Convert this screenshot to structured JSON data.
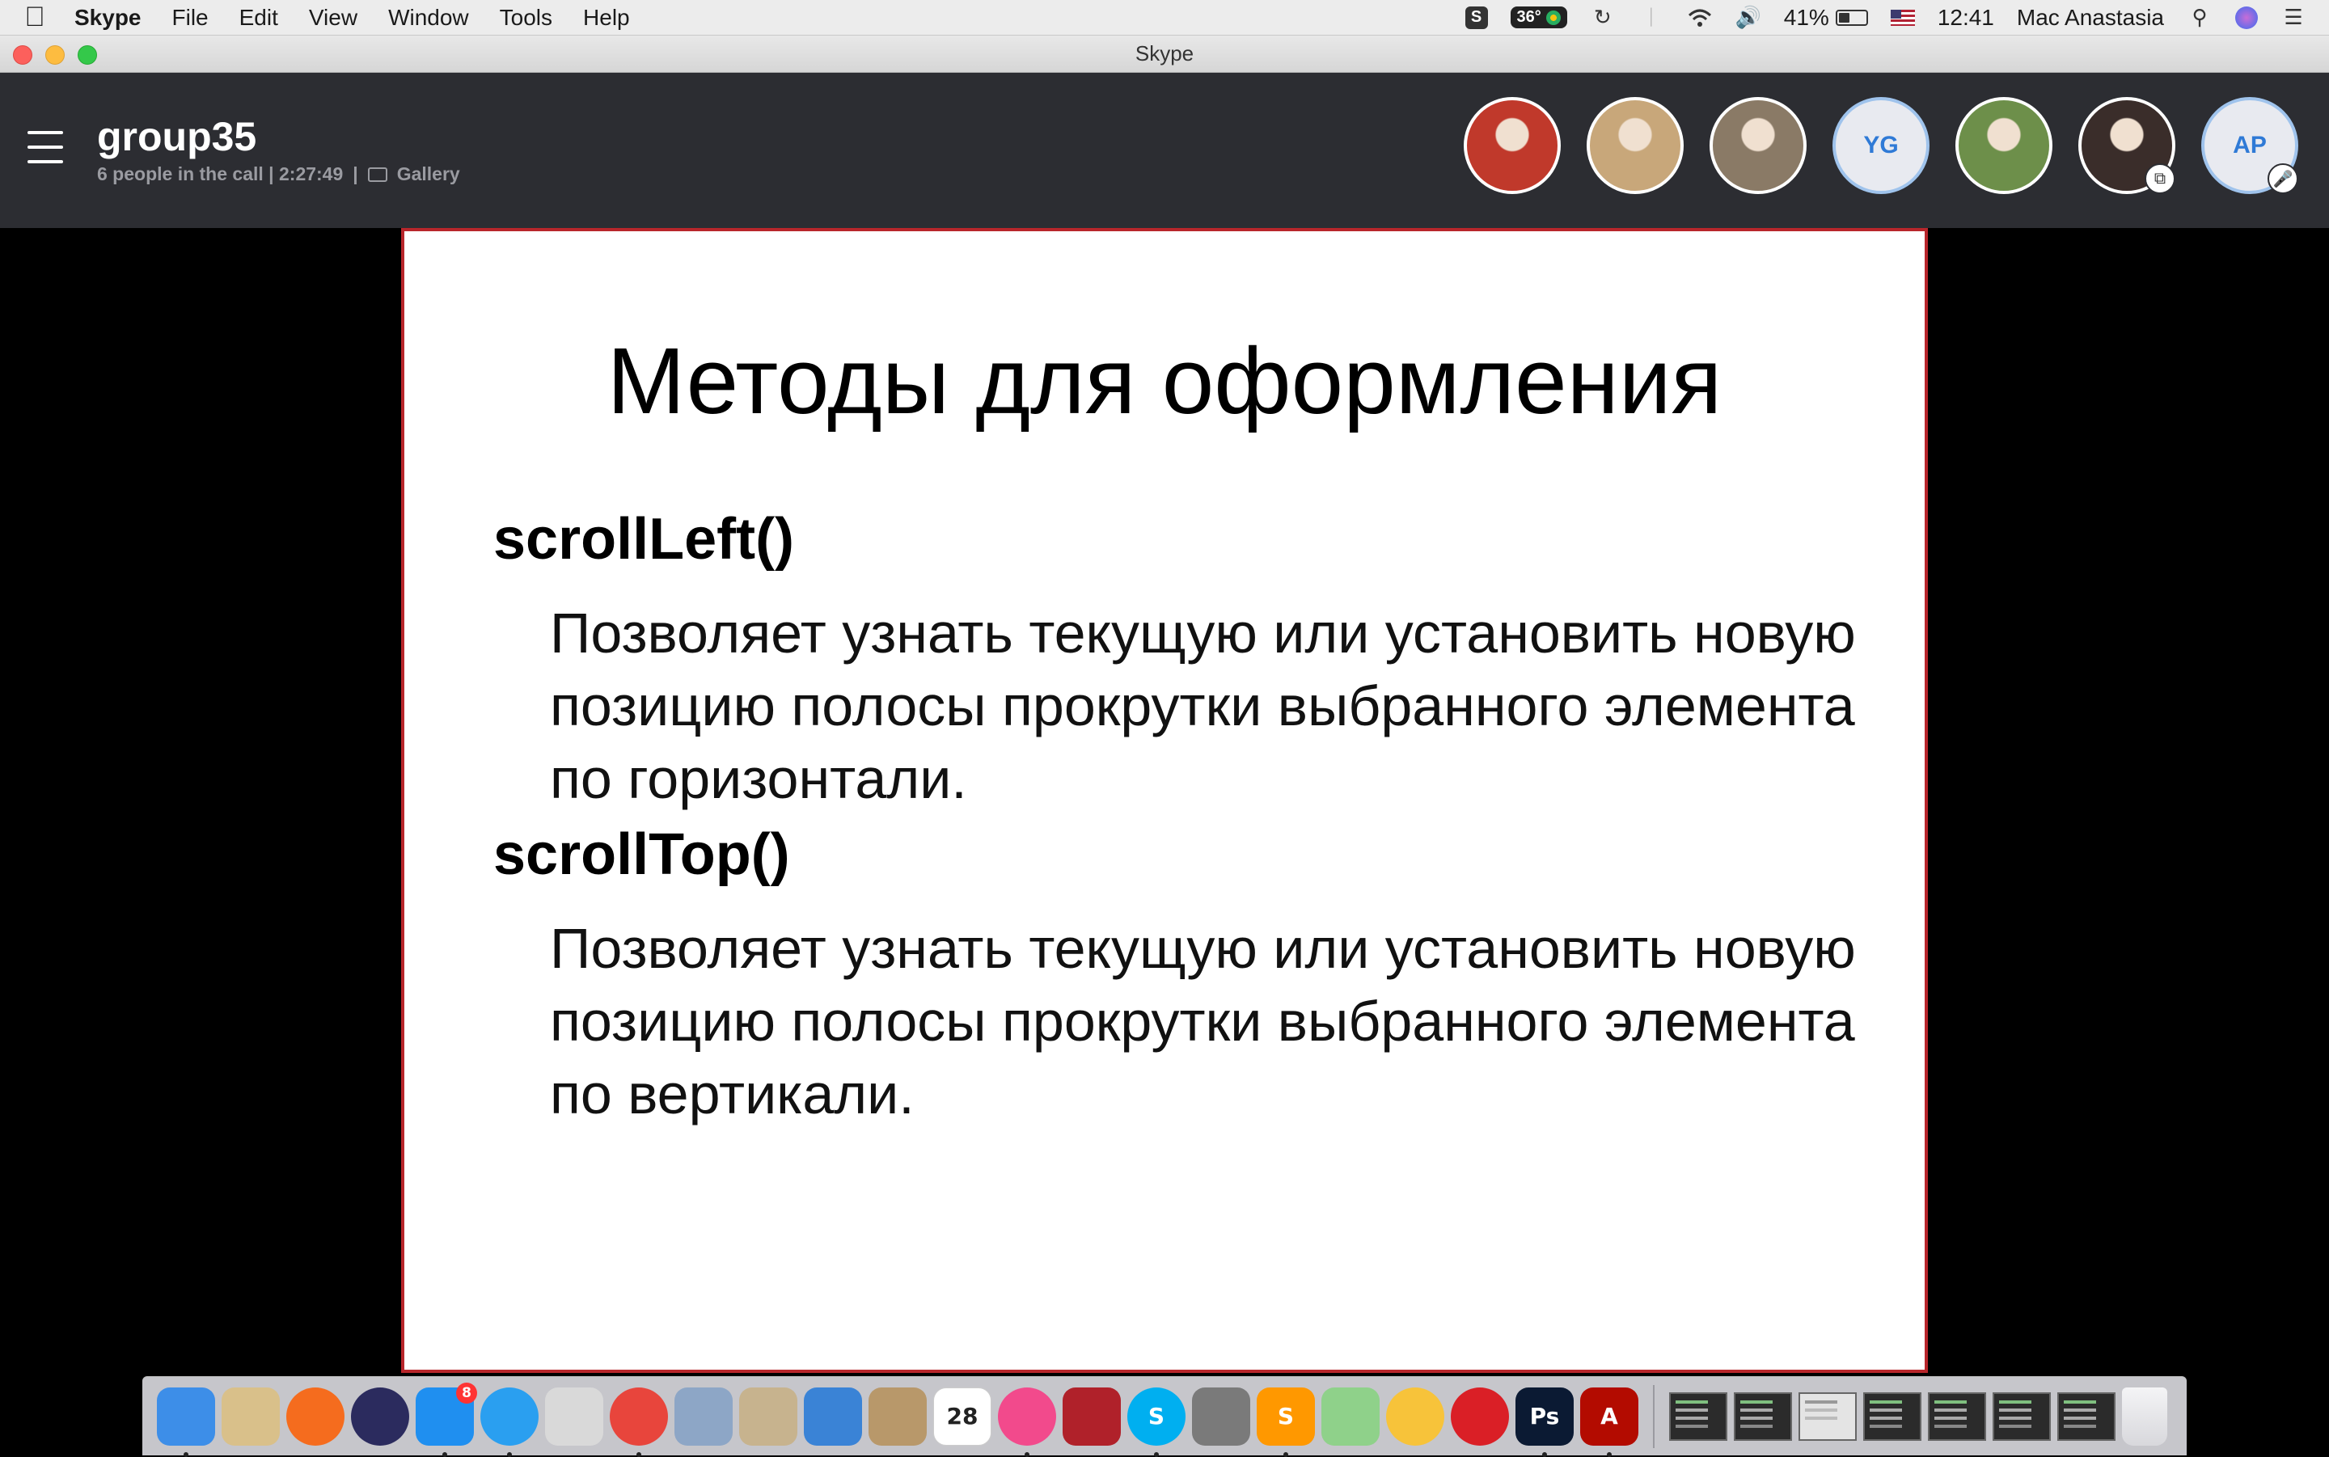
{
  "menubar": {
    "app_name": "Skype",
    "items": [
      "File",
      "Edit",
      "View",
      "Window",
      "Tools",
      "Help"
    ],
    "temperature": "36°",
    "battery_percent": "41%",
    "battery_level": 0.41,
    "time": "12:41",
    "user": "Mac Anastasia"
  },
  "window": {
    "title": "Skype"
  },
  "call": {
    "title": "group35",
    "status": "6 people in the call | 2:27:49",
    "separator": "|",
    "view_mode": "Gallery",
    "participants": [
      {
        "type": "photo",
        "icon": "devil-avatar",
        "color": "#c0392b"
      },
      {
        "type": "photo",
        "icon": "blonde-woman-avatar",
        "color": "#c8a77a"
      },
      {
        "type": "photo",
        "icon": "man-avatar",
        "color": "#8a7a66"
      },
      {
        "type": "initials",
        "initials": "YG"
      },
      {
        "type": "photo",
        "icon": "outdoor-man-avatar",
        "color": "#6d8f4a"
      },
      {
        "type": "photo",
        "icon": "woman-dark-hair-avatar",
        "color": "#3a2d2a",
        "badge": "share-icon"
      },
      {
        "type": "initials",
        "initials": "AP",
        "badge": "mic-muted-icon"
      }
    ]
  },
  "slide": {
    "title": "Методы для оформления",
    "items": [
      {
        "term": "scrollLeft()",
        "description": "Позволяет узнать текущую или установить новую позицию полосы прокрутки выбранного элемента по горизонтали."
      },
      {
        "term": "scrollTop()",
        "description": "Позволяет узнать текущую или установить новую позицию полосы прокрутки выбранного элемента по вертикали."
      }
    ],
    "border_color": "#b8262b"
  },
  "dock": {
    "apps": [
      {
        "name": "Finder",
        "icon": "finder-icon",
        "color": "#3d8ee8",
        "running": true
      },
      {
        "name": "Preview",
        "icon": "preview-icon",
        "color": "#d9c08a",
        "running": false
      },
      {
        "name": "Origin",
        "icon": "origin-icon",
        "color": "#f56c1e",
        "running": false
      },
      {
        "name": "Siri",
        "icon": "siri-icon",
        "color": "#2b2b5e",
        "running": false
      },
      {
        "name": "App Store",
        "icon": "app-store-icon",
        "color": "#1f8ff0",
        "running": true,
        "badge": "8"
      },
      {
        "name": "Safari",
        "icon": "safari-icon",
        "color": "#2a9ff0",
        "running": true
      },
      {
        "name": "Launchpad",
        "icon": "launchpad-icon",
        "color": "#d9d9d9",
        "running": false
      },
      {
        "name": "Chrome",
        "icon": "chrome-icon",
        "color": "#e8453c",
        "running": true
      },
      {
        "name": "Feather",
        "icon": "feather-icon",
        "color": "#8da6c6",
        "running": false
      },
      {
        "name": "Files",
        "icon": "files-icon",
        "color": "#c7b38e",
        "running": false
      },
      {
        "name": "Stickies",
        "icon": "stickies-icon",
        "color": "#3a83d6",
        "running": false
      },
      {
        "name": "Contacts",
        "icon": "contacts-icon",
        "color": "#b8986a",
        "running": false
      },
      {
        "name": "Calendar",
        "icon": "calendar-icon",
        "color": "#ffffff",
        "label": "28",
        "running": false
      },
      {
        "name": "iTunes",
        "icon": "itunes-icon",
        "color": "#f24a8c",
        "running": true
      },
      {
        "name": "Photo Booth",
        "icon": "photo-booth-icon",
        "color": "#b0212a",
        "running": false
      },
      {
        "name": "Skype",
        "icon": "skype-icon",
        "color": "#00aff0",
        "label": "S",
        "running": true
      },
      {
        "name": "System Preferences",
        "icon": "gear-icon",
        "color": "#7a7a7a",
        "running": false
      },
      {
        "name": "Sublime Text",
        "icon": "sublime-icon",
        "color": "#ff9800",
        "label": "S",
        "running": true
      },
      {
        "name": "Maps",
        "icon": "maps-icon",
        "color": "#8fd18a",
        "running": false
      },
      {
        "name": "Photos",
        "icon": "photos-icon",
        "color": "#f7c33a",
        "running": false
      },
      {
        "name": "Creative Cloud",
        "icon": "creative-cloud-icon",
        "color": "#da1f26",
        "running": false
      },
      {
        "name": "Photoshop",
        "icon": "photoshop-icon",
        "color": "#0b1a33",
        "label": "Ps",
        "running": true
      },
      {
        "name": "Acrobat",
        "icon": "acrobat-icon",
        "color": "#b30b00",
        "label": "A",
        "running": true
      }
    ],
    "minimized": [
      {
        "icon": "window-thumbnail-photoshop-icon",
        "style": "dark"
      },
      {
        "icon": "window-thumbnail-sublime-icon",
        "style": "dark"
      },
      {
        "icon": "window-thumbnail-pdf-icon",
        "style": "light"
      },
      {
        "icon": "window-thumbnail-sublime-icon",
        "style": "dark"
      },
      {
        "icon": "window-thumbnail-sublime-icon",
        "style": "dark"
      },
      {
        "icon": "window-thumbnail-sublime-icon",
        "style": "dark"
      },
      {
        "icon": "window-thumbnail-sublime-icon",
        "style": "dark"
      }
    ],
    "trash": {
      "icon": "trash-icon",
      "color": "#d8d8dc"
    }
  }
}
